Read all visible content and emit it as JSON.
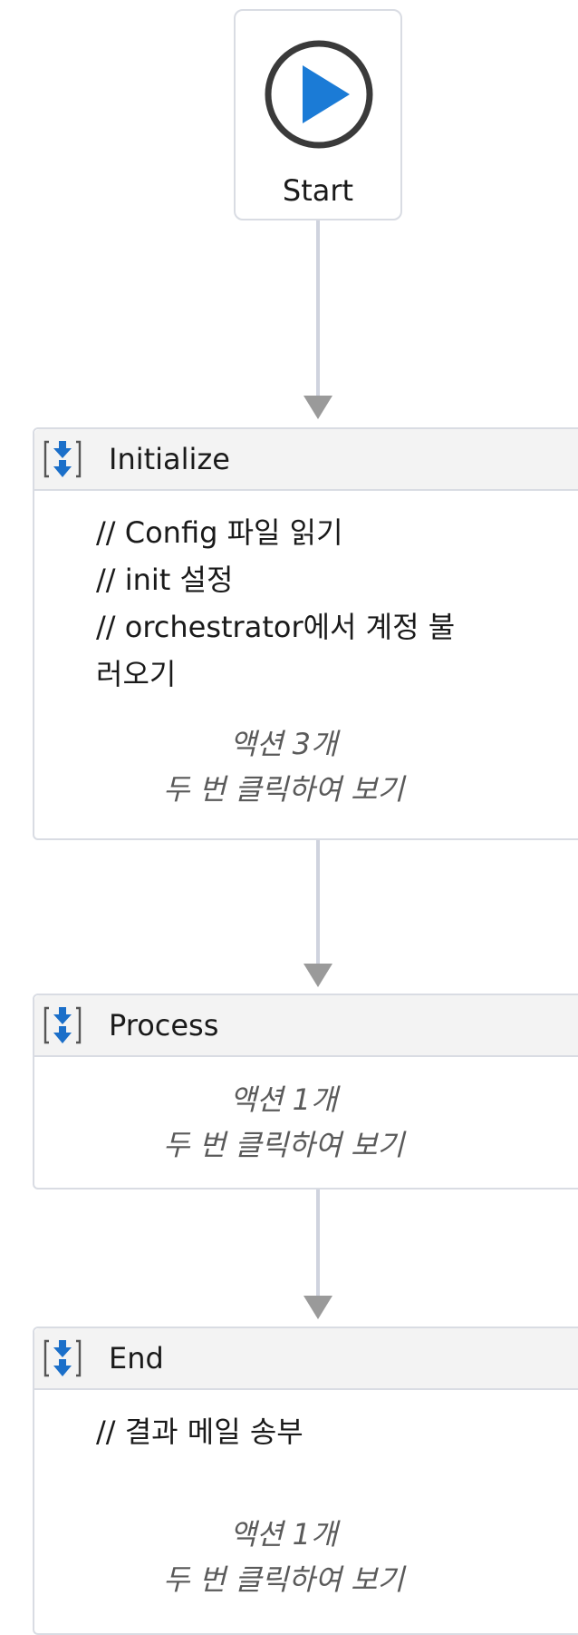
{
  "start": {
    "label": "Start"
  },
  "sequences": [
    {
      "title": "Initialize",
      "comments": [
        "// Config 파일 읽기",
        "// init 설정",
        "// orchestrator에서 계정 불",
        "러오기"
      ],
      "action_count": "액션 3개",
      "hint": "두 번 클릭하여 보기"
    },
    {
      "title": "Process",
      "comments": [],
      "action_count": "액션 1개",
      "hint": "두 번 클릭하여 보기"
    },
    {
      "title": "End",
      "comments": [
        "// 결과 메일 송부"
      ],
      "action_count": "액션 1개",
      "hint": "두 번 클릭하여 보기"
    }
  ],
  "colors": {
    "play_blue": "#1b7bd6",
    "node_border": "#d9dce3",
    "connector": "#cfd3de",
    "arrowhead": "#9a9a9a",
    "header_bg": "#f3f3f3"
  },
  "icons": {
    "start": "play-circle-icon",
    "sequence": "sequence-icon"
  }
}
